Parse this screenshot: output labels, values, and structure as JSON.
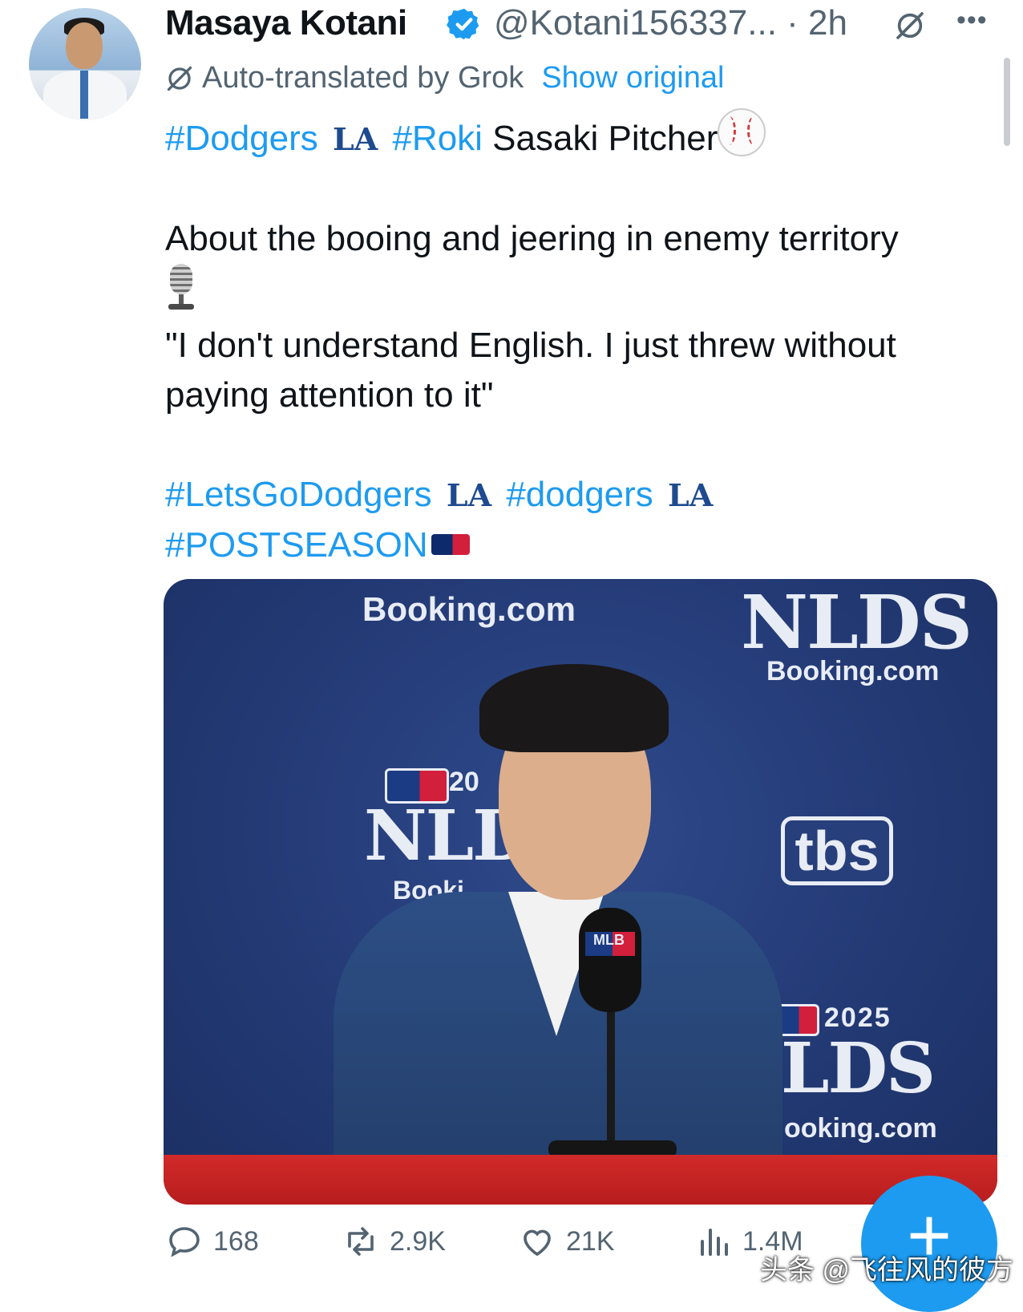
{
  "author": {
    "name": "Masaya Kotani",
    "handle": "@Kotani156337...",
    "time_sep": " · ",
    "time": "2h"
  },
  "translation": {
    "label": "Auto-translated by Grok",
    "show_original": "Show original"
  },
  "tweet": {
    "tag_dodgers": "#Dodgers",
    "tag_roki": "#Roki",
    "sasaki": " Sasaki Pitcher",
    "line_about": "About the booing and jeering in enemy territory",
    "quote": "\"I don't understand English. I just threw without paying attention to it\"",
    "tag_letsgo": "#LetsGoDodgers",
    "tag_dodgers_lower": "#dodgers",
    "tag_postseason": "#POSTSEASON",
    "la_logo": "LA"
  },
  "media": {
    "booking_top": "Booking.com",
    "nlds_top": "NLDS",
    "booking_right": "Booking.com",
    "year_left": "20",
    "nld_left": "NLD",
    "booki_left": "Booki",
    "tbs": "tbs",
    "year_right": "2025",
    "lds_right": "LDS",
    "ooking_right": "ooking.com",
    "mic_label": "MLB"
  },
  "actions": {
    "replies": "168",
    "reposts": "2.9K",
    "likes": "21K",
    "views": "1.4M"
  },
  "fab": {
    "label": "+"
  },
  "watermark": "头条 @飞往风的彼方",
  "colors": {
    "accent": "#1d9bf0",
    "secondary": "#536471",
    "la_blue": "#1e4b8f"
  }
}
